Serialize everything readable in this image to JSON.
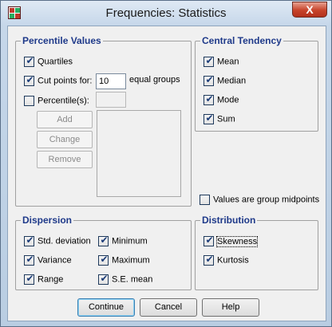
{
  "window": {
    "title": "Frequencies: Statistics",
    "close_symbol": "X"
  },
  "percentile": {
    "title": "Percentile Values",
    "quartiles": {
      "label": "Quartiles",
      "checked": true
    },
    "cut_points": {
      "label": "Cut points for:",
      "checked": true,
      "value": "10",
      "suffix": "equal groups"
    },
    "percentiles": {
      "label": "Percentile(s):",
      "checked": false,
      "value": ""
    },
    "add_label": "Add",
    "change_label": "Change",
    "remove_label": "Remove"
  },
  "central": {
    "title": "Central Tendency",
    "items": [
      {
        "label": "Mean",
        "checked": true
      },
      {
        "label": "Median",
        "checked": true
      },
      {
        "label": "Mode",
        "checked": true
      },
      {
        "label": "Sum",
        "checked": true
      }
    ],
    "midpoints": {
      "label": "Values are group midpoints",
      "checked": false
    }
  },
  "dispersion": {
    "title": "Dispersion",
    "items": [
      {
        "label": "Std. deviation",
        "checked": true
      },
      {
        "label": "Minimum",
        "checked": true
      },
      {
        "label": "Variance",
        "checked": true
      },
      {
        "label": "Maximum",
        "checked": true
      },
      {
        "label": "Range",
        "checked": true
      },
      {
        "label": "S.E. mean",
        "checked": true
      }
    ]
  },
  "distribution": {
    "title": "Distribution",
    "items": [
      {
        "label": "Skewness",
        "checked": true
      },
      {
        "label": "Kurtosis",
        "checked": true
      }
    ]
  },
  "buttons": {
    "continue": "Continue",
    "cancel": "Cancel",
    "help": "Help"
  },
  "colors": {
    "group_title": "#1f3a8a",
    "check": "#1c3c78",
    "close_button": "#c7432a"
  },
  "icons": [
    "spss-app-icon",
    "close-icon",
    "checkmark-icon"
  ]
}
